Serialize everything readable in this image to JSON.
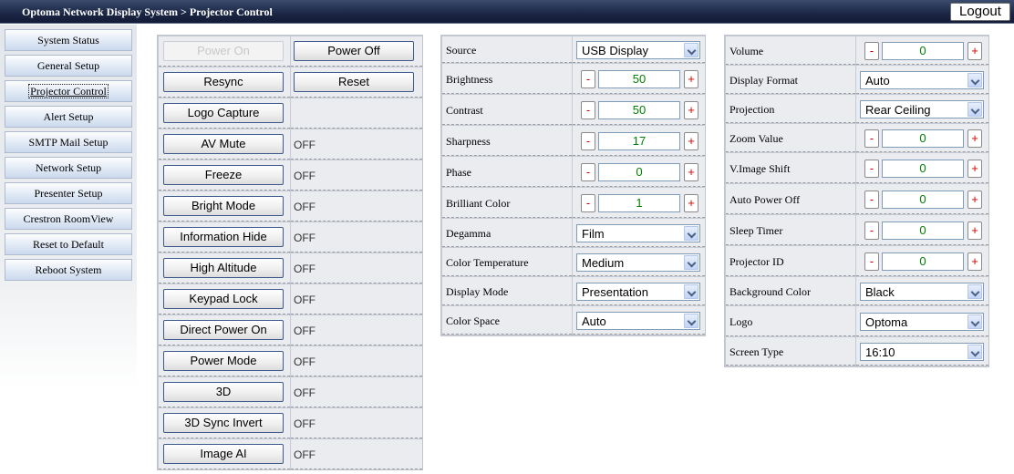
{
  "header": {
    "title": "Optoma Network Display System > Projector Control",
    "logout_label": "Logout"
  },
  "sidebar": {
    "active_index": 2,
    "items": [
      {
        "label": "System Status"
      },
      {
        "label": "General Setup"
      },
      {
        "label": "Projector Control"
      },
      {
        "label": "Alert Setup"
      },
      {
        "label": "SMTP Mail Setup"
      },
      {
        "label": "Network Setup"
      },
      {
        "label": "Presenter Setup"
      },
      {
        "label": "Crestron RoomView"
      },
      {
        "label": "Reset to Default"
      },
      {
        "label": "Reboot System"
      }
    ]
  },
  "controls": {
    "power_on_label": "Power On",
    "power_off_label": "Power Off",
    "resync_label": "Resync",
    "reset_label": "Reset",
    "logo_capture_label": "Logo Capture",
    "toggles": [
      {
        "label": "AV Mute",
        "state": "OFF"
      },
      {
        "label": "Freeze",
        "state": "OFF"
      },
      {
        "label": "Bright Mode",
        "state": "OFF"
      },
      {
        "label": "Information Hide",
        "state": "OFF"
      },
      {
        "label": "High Altitude",
        "state": "OFF"
      },
      {
        "label": "Keypad Lock",
        "state": "OFF"
      },
      {
        "label": "Direct Power On",
        "state": "OFF"
      },
      {
        "label": "Power Mode",
        "state": "OFF"
      },
      {
        "label": "3D",
        "state": "OFF"
      },
      {
        "label": "3D Sync Invert",
        "state": "OFF"
      },
      {
        "label": "Image AI",
        "state": "OFF"
      }
    ]
  },
  "picture": {
    "rows": [
      {
        "label": "Source",
        "type": "select",
        "value": "USB Display"
      },
      {
        "label": "Brightness",
        "type": "number",
        "value": "50"
      },
      {
        "label": "Contrast",
        "type": "number",
        "value": "50"
      },
      {
        "label": "Sharpness",
        "type": "number",
        "value": "17"
      },
      {
        "label": "Phase",
        "type": "number",
        "value": "0"
      },
      {
        "label": "Brilliant Color",
        "type": "number",
        "value": "1"
      },
      {
        "label": "Degamma",
        "type": "select",
        "value": "Film"
      },
      {
        "label": "Color Temperature",
        "type": "select",
        "value": "Medium"
      },
      {
        "label": "Display Mode",
        "type": "select",
        "value": "Presentation"
      },
      {
        "label": "Color Space",
        "type": "select",
        "value": "Auto"
      }
    ]
  },
  "setup": {
    "rows": [
      {
        "label": "Volume",
        "type": "number",
        "value": "0"
      },
      {
        "label": "Display Format",
        "type": "select",
        "value": "Auto"
      },
      {
        "label": "Projection",
        "type": "select",
        "value": "Rear Ceiling"
      },
      {
        "label": "Zoom Value",
        "type": "number",
        "value": "0"
      },
      {
        "label": "V.Image Shift",
        "type": "number",
        "value": "0"
      },
      {
        "label": "Auto Power Off",
        "type": "number",
        "value": "0"
      },
      {
        "label": "Sleep Timer",
        "type": "number",
        "value": "0"
      },
      {
        "label": "Projector ID",
        "type": "number",
        "value": "0"
      },
      {
        "label": "Background Color",
        "type": "select",
        "value": "Black"
      },
      {
        "label": "Logo",
        "type": "select",
        "value": "Optoma"
      },
      {
        "label": "Screen Type",
        "type": "select",
        "value": "16:10"
      }
    ]
  },
  "stepper": {
    "minus": "-",
    "plus": "+"
  }
}
